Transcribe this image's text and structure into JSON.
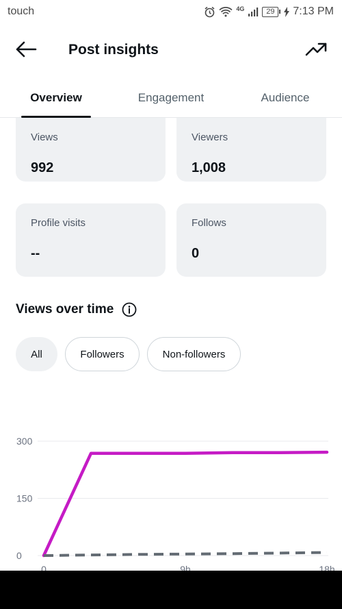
{
  "status_bar": {
    "left_text": "touch",
    "network": "4G",
    "battery": "29",
    "time": "7:13 PM"
  },
  "header": {
    "title": "Post insights",
    "back_icon": "arrow-left-icon",
    "trend_icon": "trending-up-icon"
  },
  "tabs": [
    {
      "label": "Overview",
      "active": true
    },
    {
      "label": "Engagement",
      "active": false
    },
    {
      "label": "Audience",
      "active": false
    }
  ],
  "metrics": [
    {
      "label": "Views",
      "value": "992"
    },
    {
      "label": "Viewers",
      "value": "1,008"
    },
    {
      "label": "Profile visits",
      "value": "--"
    },
    {
      "label": "Follows",
      "value": "0"
    }
  ],
  "views_section": {
    "title": "Views over time",
    "info_icon": "info-icon"
  },
  "filters": [
    {
      "label": "All",
      "selected": true
    },
    {
      "label": "Followers",
      "selected": false
    },
    {
      "label": "Non-followers",
      "selected": false
    }
  ],
  "colors": {
    "series_primary": "#c51bc5",
    "series_secondary": "#636b73",
    "card_bg": "#eff1f3"
  },
  "chart_data": {
    "type": "line",
    "ylim": [
      0,
      300
    ],
    "yticks": [
      "0",
      "150",
      "300"
    ],
    "xticks": [
      "0",
      "9h",
      "18h"
    ],
    "xlim": [
      0,
      18
    ],
    "grid": true,
    "series": [
      {
        "color": "#c51bc5",
        "dashed": false,
        "x": [
          0,
          3,
          6,
          9,
          12,
          15,
          18
        ],
        "y": [
          0,
          268,
          268,
          268,
          270,
          270,
          271
        ]
      },
      {
        "color": "#636b73",
        "dashed": true,
        "x": [
          0,
          6,
          12,
          18
        ],
        "y": [
          0,
          3,
          5,
          8
        ]
      }
    ]
  }
}
